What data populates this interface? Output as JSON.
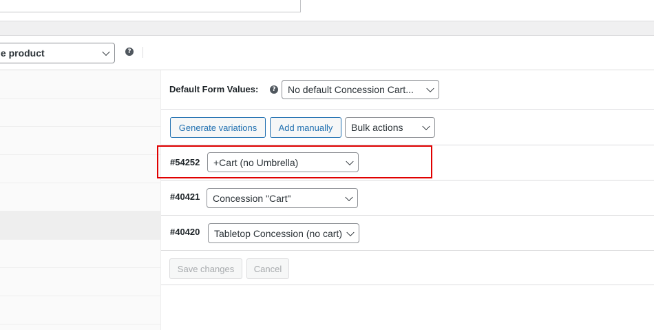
{
  "product_type": {
    "value": "le product"
  },
  "help_symbol": "?",
  "default_form": {
    "label": "Default Form Values:",
    "select_value": "No default Concession Cart..."
  },
  "actions": {
    "generate_label": "Generate variations",
    "add_manually_label": "Add manually",
    "bulk_actions_value": "Bulk actions"
  },
  "variations": [
    {
      "id": "#54252",
      "value": "+Cart (no Umbrella)"
    },
    {
      "id": "#40421",
      "value": "Concession \"Cart\""
    },
    {
      "id": "#40420",
      "value": "Tabletop Concession (no cart)"
    }
  ],
  "footer": {
    "save_label": "Save changes",
    "cancel_label": "Cancel"
  },
  "colors": {
    "accent": "#2271b1",
    "highlight": "#e00000"
  }
}
